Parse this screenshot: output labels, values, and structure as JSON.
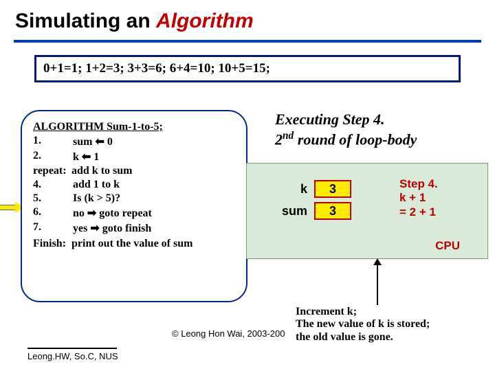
{
  "title": {
    "part1": "Simulating an ",
    "part2": "Algorithm"
  },
  "sums": "0+1=1;  1+2=3;  3+3=6;  6+4=10;  10+5=15;",
  "algo": {
    "header": "ALGORITHM Sum-1-to-5;",
    "lines": {
      "l1_no": "1.",
      "l1_txt": "sum ⬅ 0",
      "l2_no": "2.",
      "l2_txt": "k ⬅ 1",
      "l3_lbl": "repeat:",
      "l3_txt": "add k to sum",
      "l4_no": "4.",
      "l4_txt": "add 1 to k",
      "l5_no": "5.",
      "l5_txt": "Is (k > 5)?",
      "l6_no": "6.",
      "l6_txt": " no ➡ goto repeat",
      "l7_no": "7.",
      "l7_txt": " yes ➡ goto finish",
      "l8_lbl": "Finish:",
      "l8_txt": "print out the value of sum"
    }
  },
  "exec": {
    "line1": "Executing Step 4.",
    "line2a": " 2",
    "line2sup": "nd",
    "line2b": " round of loop-body"
  },
  "cpu": {
    "k_label": "k",
    "k_val": "3",
    "sum_label": "sum",
    "sum_val": "3",
    "note_l1": "Step 4.",
    "note_l2": "k + 1",
    "note_l3": "= 2 + 1",
    "label": "CPU"
  },
  "increment": {
    "l1": "Increment k;",
    "l2": "The new value of k is stored;",
    "l3": "the old value is gone."
  },
  "copyright": "© Leong Hon Wai, 2003-200",
  "footer": "Leong.HW, So.C, NUS"
}
